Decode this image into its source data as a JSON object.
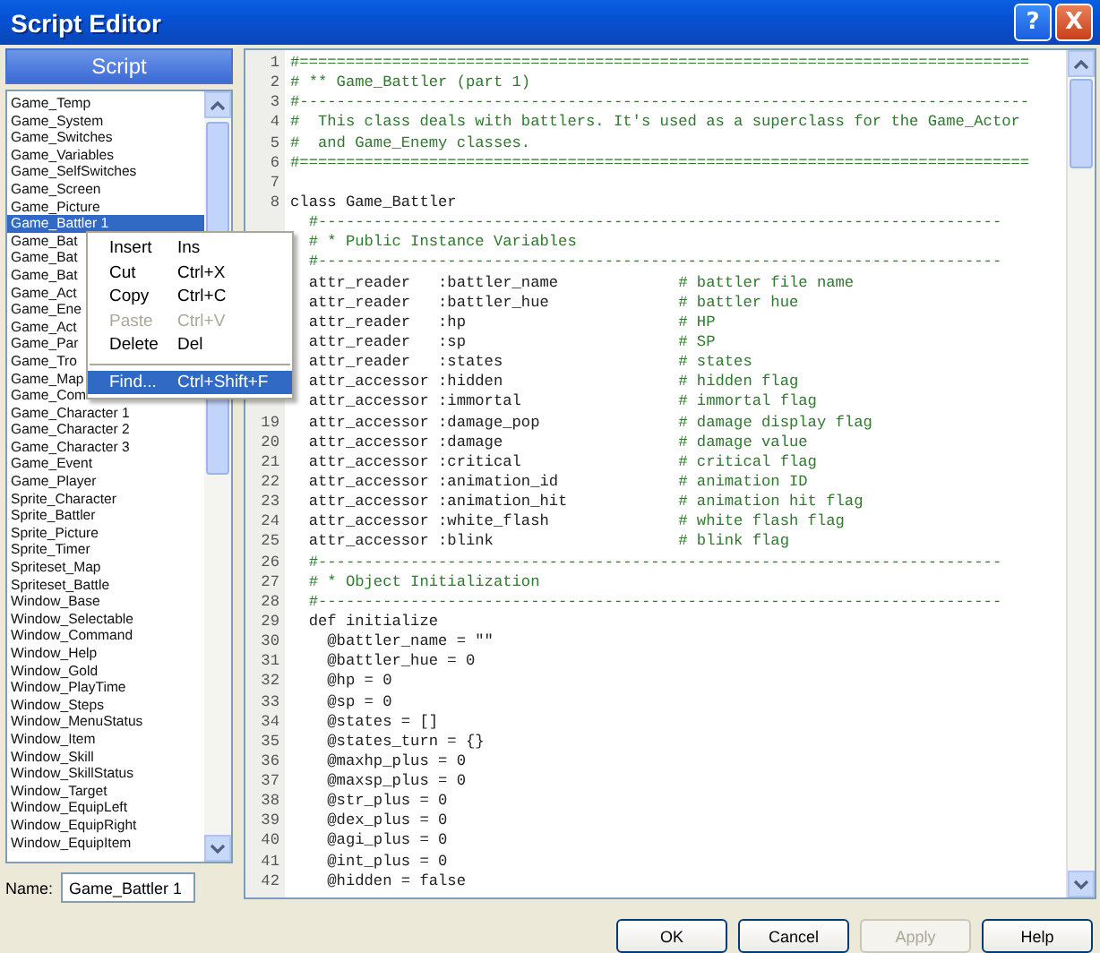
{
  "window": {
    "title": "Script Editor",
    "help_glyph": "?",
    "close_glyph": "X"
  },
  "script_list": {
    "header": "Script",
    "items": [
      {
        "label": "Game_Temp",
        "selected": false
      },
      {
        "label": "Game_System",
        "selected": false
      },
      {
        "label": "Game_Switches",
        "selected": false
      },
      {
        "label": "Game_Variables",
        "selected": false
      },
      {
        "label": "Game_SelfSwitches",
        "selected": false
      },
      {
        "label": "Game_Screen",
        "selected": false
      },
      {
        "label": "Game_Picture",
        "selected": false
      },
      {
        "label": "Game_Battler 1",
        "selected": true
      },
      {
        "label": "Game_Bat",
        "selected": false
      },
      {
        "label": "Game_Bat",
        "selected": false
      },
      {
        "label": "Game_Bat",
        "selected": false
      },
      {
        "label": "Game_Act",
        "selected": false
      },
      {
        "label": "Game_Ene",
        "selected": false
      },
      {
        "label": "Game_Act",
        "selected": false
      },
      {
        "label": "Game_Par",
        "selected": false
      },
      {
        "label": "Game_Tro",
        "selected": false
      },
      {
        "label": "Game_Map",
        "selected": false
      },
      {
        "label": "Game_Com",
        "selected": false
      },
      {
        "label": "Game_Character 1",
        "selected": false
      },
      {
        "label": "Game_Character 2",
        "selected": false
      },
      {
        "label": "Game_Character 3",
        "selected": false
      },
      {
        "label": "Game_Event",
        "selected": false
      },
      {
        "label": "Game_Player",
        "selected": false
      },
      {
        "label": "Sprite_Character",
        "selected": false
      },
      {
        "label": "Sprite_Battler",
        "selected": false
      },
      {
        "label": "Sprite_Picture",
        "selected": false
      },
      {
        "label": "Sprite_Timer",
        "selected": false
      },
      {
        "label": "Spriteset_Map",
        "selected": false
      },
      {
        "label": "Spriteset_Battle",
        "selected": false
      },
      {
        "label": "Window_Base",
        "selected": false
      },
      {
        "label": "Window_Selectable",
        "selected": false
      },
      {
        "label": "Window_Command",
        "selected": false
      },
      {
        "label": "Window_Help",
        "selected": false
      },
      {
        "label": "Window_Gold",
        "selected": false
      },
      {
        "label": "Window_PlayTime",
        "selected": false
      },
      {
        "label": "Window_Steps",
        "selected": false
      },
      {
        "label": "Window_MenuStatus",
        "selected": false
      },
      {
        "label": "Window_Item",
        "selected": false
      },
      {
        "label": "Window_Skill",
        "selected": false
      },
      {
        "label": "Window_SkillStatus",
        "selected": false
      },
      {
        "label": "Window_Target",
        "selected": false
      },
      {
        "label": "Window_EquipLeft",
        "selected": false
      },
      {
        "label": "Window_EquipRight",
        "selected": false
      },
      {
        "label": "Window_EquipItem",
        "selected": false
      }
    ]
  },
  "context_menu": {
    "items": [
      {
        "label": "Insert",
        "shortcut": "Ins",
        "disabled": false,
        "selected": false
      },
      {
        "label": "Cut",
        "shortcut": "Ctrl+X",
        "disabled": false,
        "selected": false
      },
      {
        "label": "Copy",
        "shortcut": "Ctrl+C",
        "disabled": false,
        "selected": false
      },
      {
        "label": "Paste",
        "shortcut": "Ctrl+V",
        "disabled": true,
        "selected": false
      },
      {
        "label": "Delete",
        "shortcut": "Del",
        "disabled": false,
        "selected": false
      },
      {
        "kind": "separator"
      },
      {
        "label": "Find...",
        "shortcut": "Ctrl+Shift+F",
        "disabled": false,
        "selected": true
      }
    ]
  },
  "name_field": {
    "label": "Name:",
    "value": "Game_Battler 1"
  },
  "code": {
    "lines": [
      {
        "num": "1",
        "kind": "comment",
        "text": "#==============================================================================="
      },
      {
        "num": "2",
        "kind": "comment",
        "text": "# ** Game_Battler (part 1)"
      },
      {
        "num": "3",
        "kind": "comment",
        "text": "#-------------------------------------------------------------------------------"
      },
      {
        "num": "4",
        "kind": "comment",
        "text": "#  This class deals with battlers. It's used as a superclass for the Game_Actor"
      },
      {
        "num": "5",
        "kind": "comment",
        "text": "#  and Game_Enemy classes."
      },
      {
        "num": "6",
        "kind": "comment",
        "text": "#==============================================================================="
      },
      {
        "num": "7"
      },
      {
        "num": "8",
        "kind": "code",
        "text": "class Game_Battler"
      },
      {
        "kind": "comment",
        "text": "  #--------------------------------------------------------------------------"
      },
      {
        "kind": "comment",
        "text": "  # * Public Instance Variables"
      },
      {
        "kind": "comment",
        "text": "  #--------------------------------------------------------------------------"
      },
      {
        "kind": "code",
        "text": "  attr_reader   :battler_name",
        "note": "# battler file name"
      },
      {
        "kind": "code",
        "text": "  attr_reader   :battler_hue",
        "note": "# battler hue"
      },
      {
        "kind": "code",
        "text": "  attr_reader   :hp",
        "note": "# HP"
      },
      {
        "kind": "code",
        "text": "  attr_reader   :sp",
        "note": "# SP"
      },
      {
        "kind": "code",
        "text": "  attr_reader   :states",
        "note": "# states"
      },
      {
        "kind": "code",
        "text": "  attr_accessor :hidden",
        "note": "# hidden flag"
      },
      {
        "kind": "code",
        "text": "  attr_accessor :immortal",
        "note": "# immortal flag"
      },
      {
        "num": "19",
        "kind": "code",
        "text": "  attr_accessor :damage_pop",
        "note": "# damage display flag"
      },
      {
        "num": "20",
        "kind": "code",
        "text": "  attr_accessor :damage",
        "note": "# damage value"
      },
      {
        "num": "21",
        "kind": "code",
        "text": "  attr_accessor :critical",
        "note": "# critical flag"
      },
      {
        "num": "22",
        "kind": "code",
        "text": "  attr_accessor :animation_id",
        "note": "# animation ID"
      },
      {
        "num": "23",
        "kind": "code",
        "text": "  attr_accessor :animation_hit",
        "note": "# animation hit flag"
      },
      {
        "num": "24",
        "kind": "code",
        "text": "  attr_accessor :white_flash",
        "note": "# white flash flag"
      },
      {
        "num": "25",
        "kind": "code",
        "text": "  attr_accessor :blink",
        "note": "# blink flag"
      },
      {
        "num": "26",
        "kind": "comment",
        "text": "  #--------------------------------------------------------------------------"
      },
      {
        "num": "27",
        "kind": "comment",
        "text": "  # * Object Initialization"
      },
      {
        "num": "28",
        "kind": "comment",
        "text": "  #--------------------------------------------------------------------------"
      },
      {
        "num": "29",
        "kind": "code",
        "text": "  def initialize"
      },
      {
        "num": "30",
        "kind": "code",
        "text": "    @battler_name = \"\""
      },
      {
        "num": "31",
        "kind": "code",
        "text": "    @battler_hue = 0"
      },
      {
        "num": "32",
        "kind": "code",
        "text": "    @hp = 0"
      },
      {
        "num": "33",
        "kind": "code",
        "text": "    @sp = 0"
      },
      {
        "num": "34",
        "kind": "code",
        "text": "    @states = []"
      },
      {
        "num": "35",
        "kind": "code",
        "text": "    @states_turn = {}"
      },
      {
        "num": "36",
        "kind": "code",
        "text": "    @maxhp_plus = 0"
      },
      {
        "num": "37",
        "kind": "code",
        "text": "    @maxsp_plus = 0"
      },
      {
        "num": "38",
        "kind": "code",
        "text": "    @str_plus = 0"
      },
      {
        "num": "39",
        "kind": "code",
        "text": "    @dex_plus = 0"
      },
      {
        "num": "40",
        "kind": "code",
        "text": "    @agi_plus = 0"
      },
      {
        "num": "41",
        "kind": "code",
        "text": "    @int_plus = 0"
      },
      {
        "num": "42",
        "kind": "code",
        "text": "    @hidden = false"
      }
    ]
  },
  "buttons": [
    {
      "label": "OK",
      "disabled": false
    },
    {
      "label": "Cancel",
      "disabled": false
    },
    {
      "label": "Apply",
      "disabled": true
    },
    {
      "label": "Help",
      "disabled": false
    }
  ]
}
